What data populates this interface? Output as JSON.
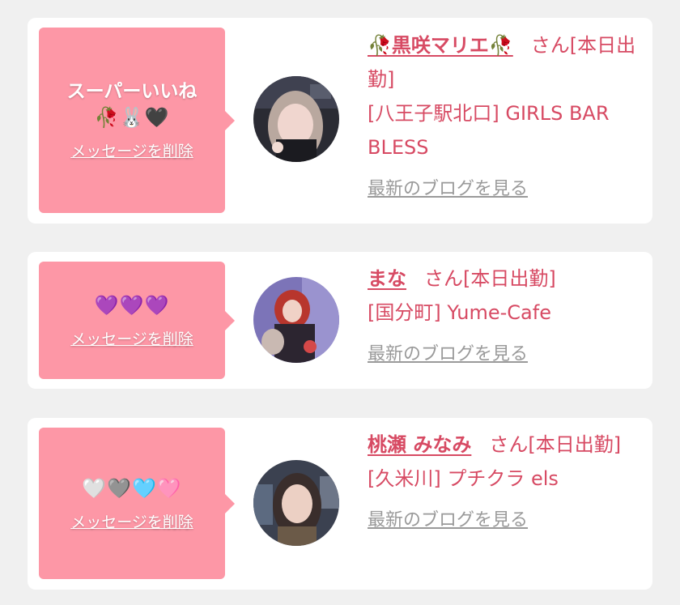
{
  "cards": [
    {
      "message": "スーパーいいね",
      "emoji": "🥀🐰🖤",
      "delete_label": "メッセージを削除",
      "name": "🥀黒咲マリエ🥀",
      "honorific": "さん[本日出勤]",
      "shop": "[八王子駅北口] GIRLS BAR BLESS",
      "blog_label": "最新のブログを見る"
    },
    {
      "message": "",
      "emoji": "💜💜💜",
      "delete_label": "メッセージを削除",
      "name": "まな",
      "honorific": "さん[本日出勤]",
      "shop": "[国分町] Yume-Cafe",
      "blog_label": "最新のブログを見る"
    },
    {
      "message": "",
      "emoji": "🤍🩶🩵🩷",
      "delete_label": "メッセージを削除",
      "name": "桃瀬 みなみ",
      "honorific": "さん[本日出勤]",
      "shop": "[久米川] プチクラ els",
      "blog_label": "最新のブログを見る"
    }
  ],
  "colors": {
    "background": "#f0f0f0",
    "bubble": "#fd97a6",
    "accent_text": "#d74a63",
    "link_gray": "#9a9a9a"
  }
}
